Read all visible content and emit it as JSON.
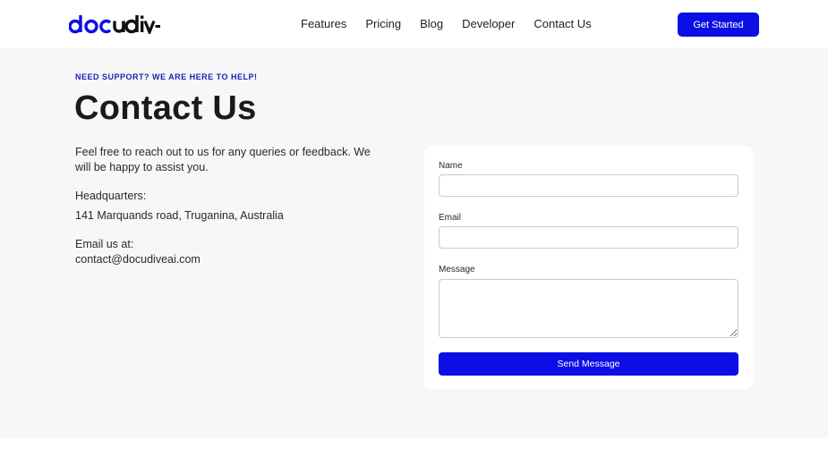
{
  "brand": {
    "logo_text": "docudive",
    "accent_color": "#0b0fe6",
    "logo_colors": [
      "#0b0fe6",
      "#111111"
    ]
  },
  "nav": {
    "links": [
      {
        "label": "Features"
      },
      {
        "label": "Pricing"
      },
      {
        "label": "Blog"
      },
      {
        "label": "Developer"
      },
      {
        "label": "Contact Us"
      }
    ],
    "cta_label": "Get Started"
  },
  "contact": {
    "eyebrow": "NEED SUPPORT? WE ARE HERE TO HELP!",
    "title": "Contact Us",
    "intro": "Feel free to reach out to us for any queries or feedback. We will be happy to assist you.",
    "hq_label": "Headquarters:",
    "hq_address": "141 Marquands road, Truganina, Australia",
    "email_label": "Email us at:",
    "email_value": "contact@docudiveai.com"
  },
  "form": {
    "name_label": "Name",
    "name_value": "",
    "email_label": "Email",
    "email_value": "",
    "message_label": "Message",
    "message_value": "",
    "submit_label": "Send Message"
  }
}
